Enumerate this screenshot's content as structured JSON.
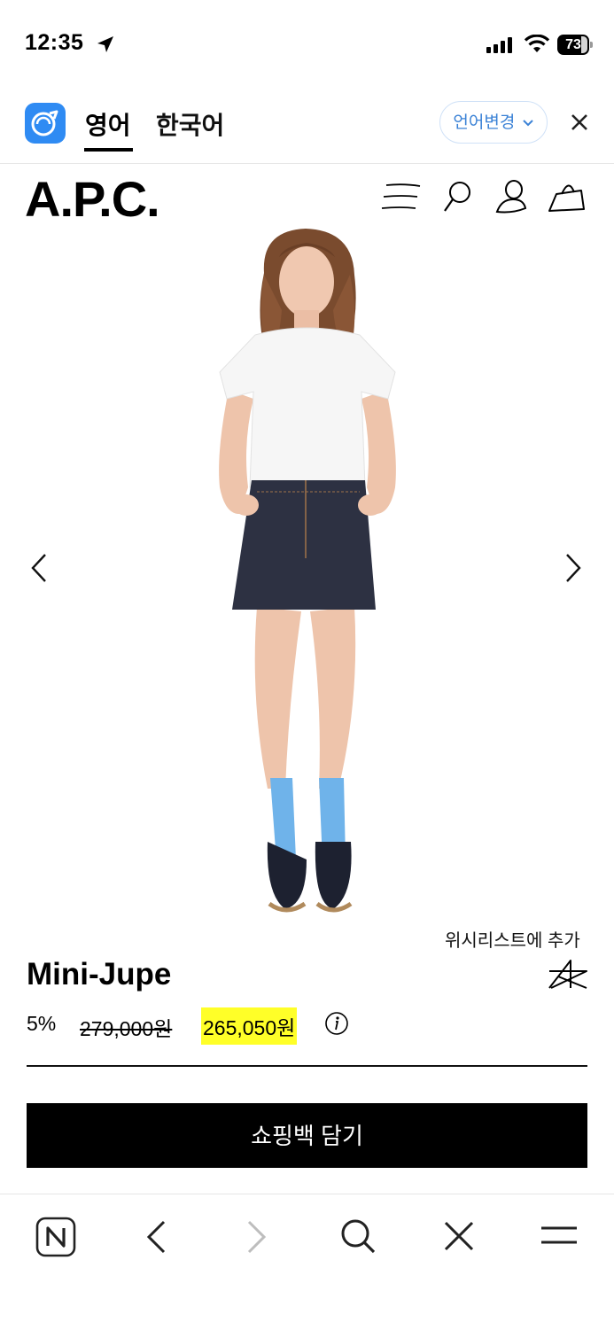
{
  "status_bar": {
    "time": "12:35",
    "battery": "73"
  },
  "translate_bar": {
    "tab_english": "영어",
    "tab_korean": "한국어",
    "change_language": "언어변경"
  },
  "site": {
    "logo": "A.P.C."
  },
  "product": {
    "wishlist_label": "위시리스트에 추가",
    "name": "Mini-Jupe",
    "discount": "5%",
    "original_price": "279,000원",
    "sale_price": "265,050원",
    "add_to_bag": "쇼핑백 담기"
  },
  "colors": {
    "accent_blue": "#2f8bf3",
    "highlight": "#ffff28",
    "sock_blue": "#6fb3ea"
  },
  "icons": [
    "location-arrow-icon",
    "signal-icon",
    "wifi-icon",
    "battery-icon",
    "papago-logo-icon",
    "chevron-down-icon",
    "close-icon",
    "menu-icon",
    "search-icon",
    "account-icon",
    "bag-icon",
    "chevron-left-icon",
    "chevron-right-icon",
    "star-icon",
    "info-icon",
    "naver-icon",
    "back-icon",
    "forward-icon",
    "toolbar-search-icon",
    "toolbar-close-icon",
    "toolbar-menu-icon"
  ]
}
